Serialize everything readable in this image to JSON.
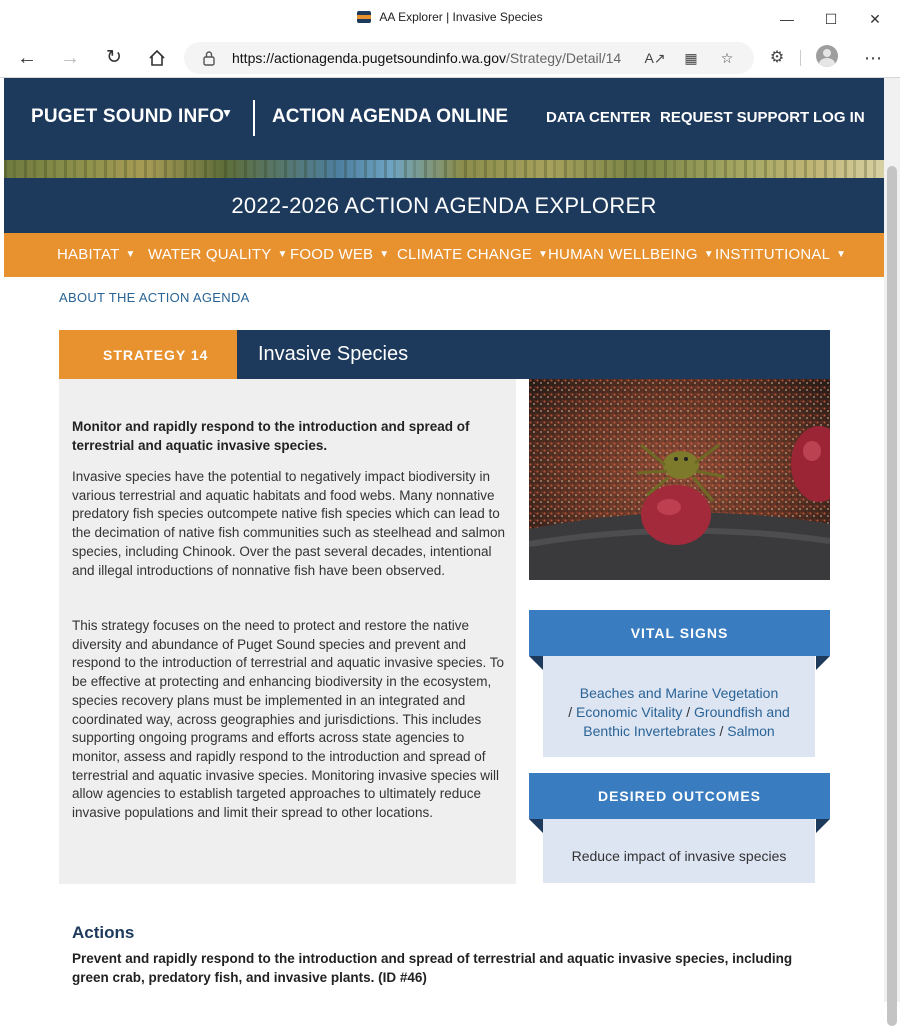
{
  "browser": {
    "tab_title": "AA Explorer | Invasive Species",
    "url_host": "https://actionagenda.pugetsoundinfo.wa.gov",
    "url_path": "/Strategy/Detail/14"
  },
  "header": {
    "brand": "PUGET SOUND INFO",
    "app_name": "ACTION AGENDA ONLINE",
    "nav": [
      "DATA CENTER",
      "REQUEST SUPPORT",
      "LOG IN"
    ],
    "explorer_title": "2022-2026 ACTION AGENDA EXPLORER"
  },
  "orange_nav": [
    "HABITAT",
    "WATER QUALITY",
    "FOOD WEB",
    "CLIMATE CHANGE",
    "HUMAN WELLBEING",
    "INSTITUTIONAL"
  ],
  "about_link": "ABOUT THE ACTION AGENDA",
  "strategy": {
    "tab_label": "STRATEGY 14",
    "title": "Invasive Species",
    "lead": "Monitor and rapidly respond to the introduction and spread of terrestrial and aquatic invasive species.",
    "paragraphs": [
      "Invasive species have the potential to negatively impact biodiversity in various terrestrial and aquatic habitats and food webs. Many nonnative predatory fish species outcompete native fish species which can lead to the decimation of native fish communities such as steelhead and salmon species, including Chinook. Over the past several decades, intentional and illegal introductions of nonnative fish have been observed.",
      "This strategy focuses on the need to protect and restore the native diversity and abundance of Puget Sound species and prevent and respond to the introduction of terrestrial and aquatic invasive species. To be effective at protecting and enhancing biodiversity in the ecosystem, species recovery plans must be implemented in an integrated and coordinated way, across geographies and jurisdictions. This includes supporting ongoing programs and efforts across state agencies to monitor, assess and rapidly respond to the introduction and spread of terrestrial and aquatic invasive species. Monitoring invasive species will allow agencies to establish targeted approaches to ultimately reduce invasive populations and limit their spread to other locations."
    ]
  },
  "vital_signs": {
    "title": "VITAL SIGNS",
    "links": [
      "Beaches and Marine Vegetation",
      "Economic Vitality",
      "Groundfish and Benthic Invertebrates",
      "Salmon"
    ]
  },
  "desired_outcomes": {
    "title": "DESIRED OUTCOMES",
    "items": [
      "Reduce impact of invasive species"
    ]
  },
  "actions": {
    "title": "Actions",
    "items": [
      "Prevent and rapidly respond to the introduction and spread of terrestrial and aquatic invasive species, including green crab, predatory fish, and invasive plants. (ID #46)"
    ]
  },
  "colors": {
    "navy": "#1d3a5c",
    "orange": "#e8912f",
    "ribbon_blue": "#3a7cc0",
    "link_blue": "#2a6496"
  }
}
